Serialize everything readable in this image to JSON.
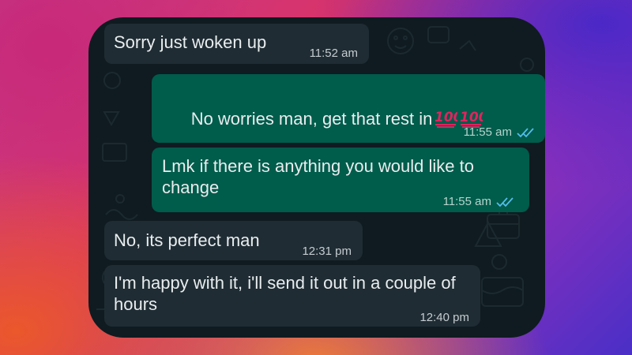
{
  "conversation": {
    "messages": [
      {
        "direction": "incoming",
        "text": "Sorry just woken up",
        "time": "11:52 am"
      },
      {
        "direction": "outgoing",
        "text": "No worries man, get that rest in",
        "emoji": [
          "hundred-points-emoji",
          "hundred-points-emoji"
        ],
        "time": "11:55 am",
        "status": "read-double-tick"
      },
      {
        "direction": "outgoing",
        "text": "Lmk if there is anything you would like to change",
        "time": "11:55 am",
        "status": "read-double-tick"
      },
      {
        "direction": "incoming",
        "text": "No, its perfect man",
        "time": "12:31 pm"
      },
      {
        "direction": "incoming",
        "text": "I'm happy with it, i'll send it out in a couple of hours",
        "time": "12:40 pm"
      }
    ]
  },
  "colors": {
    "incoming_bubble": "#1f2c33",
    "outgoing_bubble": "#005c4b",
    "read_tick": "#53bdeb",
    "chat_background": "#0f1b20"
  }
}
